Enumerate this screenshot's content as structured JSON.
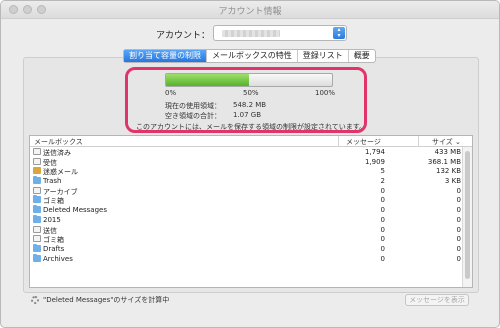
{
  "window": {
    "title": "アカウント情報"
  },
  "account": {
    "label": "アカウント："
  },
  "tabs": [
    {
      "label": "割り当て容量の制限",
      "active": true
    },
    {
      "label": "メールボックスの特性",
      "active": false
    },
    {
      "label": "登録リスト",
      "active": false
    },
    {
      "label": "概要",
      "active": false
    }
  ],
  "quota": {
    "used_fraction": 0.5,
    "ticks": [
      "0%",
      "50%",
      "100%"
    ],
    "used_label": "現在の使用領域：",
    "used_value": "548.2 MB",
    "free_label": "空き領域の合計：",
    "free_value": "1.07 GB",
    "note": "このアカウントには、メールを保存する領域の制限が設定されています。"
  },
  "table": {
    "headers": {
      "name": "メールボックス",
      "messages": "メッセージ",
      "size": "サイズ ⌄"
    },
    "rows": [
      {
        "icon": "sent",
        "name": "送信済み",
        "messages": "1,794",
        "size": "433 MB"
      },
      {
        "icon": "inbox",
        "name": "受信",
        "messages": "1,909",
        "size": "368.1 MB"
      },
      {
        "icon": "junk",
        "name": "迷惑メール",
        "messages": "5",
        "size": "132 KB"
      },
      {
        "icon": "folder",
        "name": "Trash",
        "messages": "2",
        "size": "3 KB"
      },
      {
        "icon": "archive",
        "name": "アーカイブ",
        "messages": "0",
        "size": "0"
      },
      {
        "icon": "folder",
        "name": "ゴミ箱",
        "messages": "0",
        "size": "0"
      },
      {
        "icon": "folder",
        "name": "Deleted Messages",
        "messages": "0",
        "size": "0"
      },
      {
        "icon": "folder",
        "name": "2015",
        "messages": "0",
        "size": "0"
      },
      {
        "icon": "draft",
        "name": "送信",
        "messages": "0",
        "size": "0"
      },
      {
        "icon": "trashcan",
        "name": "ゴミ箱",
        "messages": "0",
        "size": "0"
      },
      {
        "icon": "folder",
        "name": "Drafts",
        "messages": "0",
        "size": "0"
      },
      {
        "icon": "folder",
        "name": "Archives",
        "messages": "0",
        "size": "0"
      }
    ]
  },
  "status": {
    "text": "\"Deleted Messages\"のサイズを計算中"
  },
  "buttons": {
    "show_messages": "メッセージを表示"
  },
  "colors": {
    "accent": "#2677e0",
    "highlight": "#e0346b",
    "bar_fill": "#55b32d"
  }
}
